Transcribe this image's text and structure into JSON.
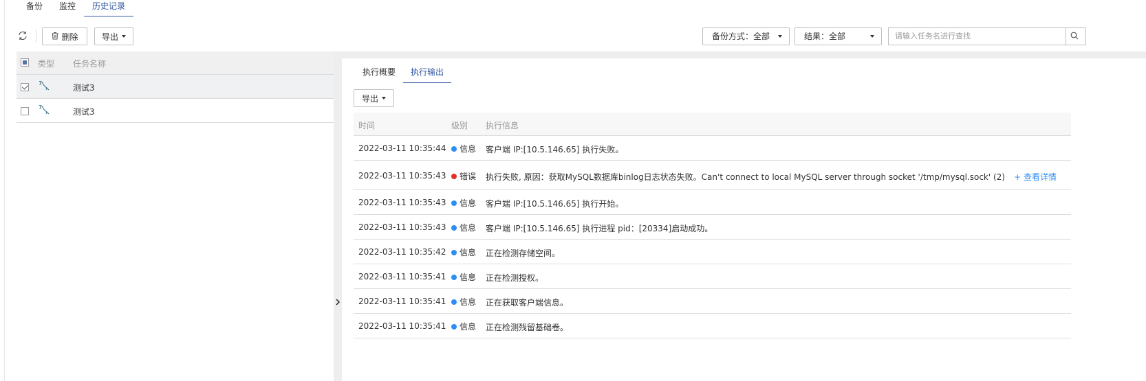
{
  "top_tabs": [
    {
      "label": "备份"
    },
    {
      "label": "监控"
    },
    {
      "label": "历史记录"
    }
  ],
  "toolbar": {
    "delete_label": "删除",
    "export_label": "导出",
    "filter_method": "备份方式：全部",
    "filter_result": "结果：全部",
    "search_placeholder": "请输入任务名进行查找"
  },
  "task_table": {
    "headers": {
      "type": "类型",
      "name": "任务名称"
    },
    "rows": [
      {
        "name": "测试3",
        "checked": true
      },
      {
        "name": "测试3",
        "checked": false
      }
    ]
  },
  "detail": {
    "tabs": [
      {
        "label": "执行概要"
      },
      {
        "label": "执行输出"
      }
    ],
    "export_label": "导出",
    "headers": {
      "time": "时间",
      "level": "级别",
      "message": "执行信息"
    },
    "detail_link": "+ 查看详情",
    "logs": [
      {
        "time": "2022-03-11 10:35:44",
        "level": "信息",
        "status": "info",
        "message": "客户端 IP:[10.5.146.65] 执行失败。"
      },
      {
        "time": "2022-03-11 10:35:43",
        "level": "错误",
        "status": "error",
        "message": "执行失败, 原因：获取MySQL数据库binlog日志状态失败。Can't connect to local MySQL server through socket '/tmp/mysql.sock' (2)"
      },
      {
        "time": "2022-03-11 10:35:43",
        "level": "信息",
        "status": "info",
        "message": "客户端 IP:[10.5.146.65] 执行开始。"
      },
      {
        "time": "2022-03-11 10:35:43",
        "level": "信息",
        "status": "info",
        "message": "客户端 IP:[10.5.146.65] 执行进程 pid：[20334]启动成功。"
      },
      {
        "time": "2022-03-11 10:35:42",
        "level": "信息",
        "status": "info",
        "message": "正在检测存储空间。"
      },
      {
        "time": "2022-03-11 10:35:41",
        "level": "信息",
        "status": "info",
        "message": "正在检测授权。"
      },
      {
        "time": "2022-03-11 10:35:41",
        "level": "信息",
        "status": "info",
        "message": "正在获取客户端信息。"
      },
      {
        "time": "2022-03-11 10:35:41",
        "level": "信息",
        "status": "info",
        "message": "正在检测残留基础卷。"
      }
    ]
  },
  "colors": {
    "accent": "#2f54a0",
    "link": "#2c8ef4",
    "info_dot": "#2c8ef4",
    "error_dot": "#e0312b"
  },
  "icons": {
    "refresh": "refresh-icon",
    "delete": "trash-icon",
    "search": "search-icon",
    "db_type": "mysql-dolphin-icon",
    "collapse": "chevron-right-icon"
  }
}
